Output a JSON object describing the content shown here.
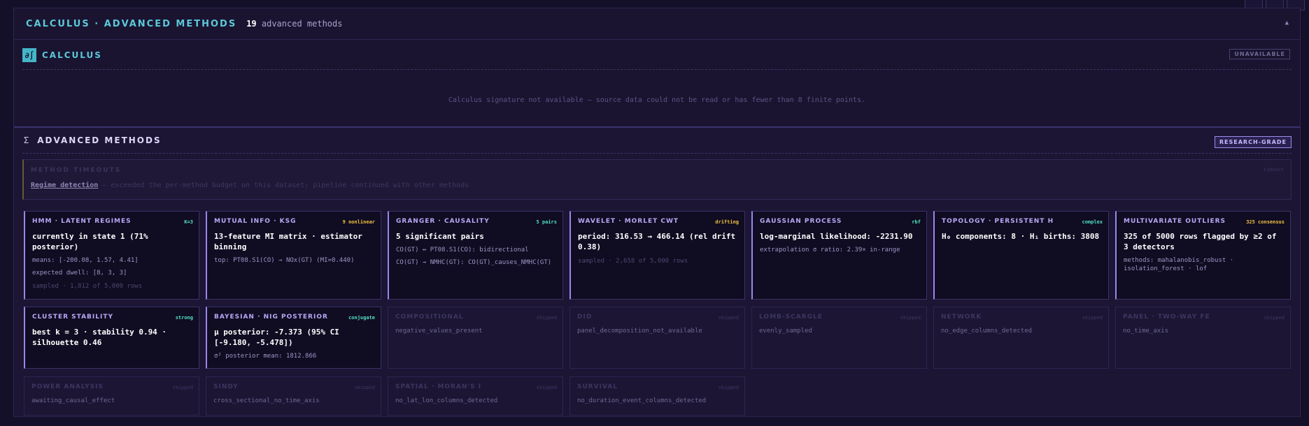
{
  "header": {
    "title": "Calculus · Advanced Methods",
    "count": "19",
    "count_suffix": " advanced methods",
    "toggle": "▲"
  },
  "calculus": {
    "icon": "∂∫",
    "title": "Calculus",
    "status": "Unavailable",
    "message": "Calculus signature not available — source data could not be read or has fewer than 8 finite points."
  },
  "advanced": {
    "symbol": "Σ",
    "title": "Advanced Methods",
    "badge": "Research-grade",
    "timeout": {
      "title": "Method Timeouts",
      "badge": "timeout",
      "method": "Regime detection",
      "message": " — exceeded the per-method budget on this dataset; pipeline continued with other methods"
    }
  },
  "cards": [
    {
      "title": "HMM · Latent Regimes",
      "badge": "K=3",
      "headline": "currently in state 1 (71% posterior)",
      "lines": [
        "means: [-200.08, 1.57, 4.41]",
        "expected dwell: [8, 3, 3]"
      ],
      "muted": "sampled · 1,812 of 5,000 rows"
    },
    {
      "title": "Mutual Info · KSG",
      "badge": "9 nonlinear",
      "headline": "13-feature MI matrix · estimator binning",
      "lines": [
        "top: PT08.S1(CO) → NOx(GT) (MI=0.440)"
      ]
    },
    {
      "title": "Granger · Causality",
      "badge": "5 pairs",
      "headline": "5 significant pairs",
      "lines": [
        "CO(GT) ↔ PT08.S1(CO): bidirectional",
        "CO(GT) → NMHC(GT): CO(GT)_causes_NMHC(GT)"
      ]
    },
    {
      "title": "Wavelet · Morlet CWT",
      "badge": "drifting",
      "headline": "period: 316.53 → 466.14 (rel drift 0.38)",
      "muted": "sampled · 2,658 of 5,000 rows"
    },
    {
      "title": "Gaussian Process",
      "badge": "rbf",
      "headline": "log-marginal likelihood: -2231.90",
      "lines": [
        "extrapolation σ ratio: 2.39× in-range"
      ]
    },
    {
      "title": "Topology · Persistent H",
      "badge": "complex",
      "headline": "H₀ components: 8 · H₁ births: 3808"
    },
    {
      "title": "Multivariate Outliers",
      "badge": "325 consensus",
      "headline": "325 of 5000 rows flagged by ≥2 of 3 detectors",
      "lines": [
        "methods: mahalanobis_robust · isolation_forest · lof"
      ]
    },
    {
      "title": "Cluster Stability",
      "badge": "strong",
      "headline": "best k = 3 · stability 0.94 · silhouette 0.46"
    },
    {
      "title": "Bayesian · NIG Posterior",
      "badge": "conjugate",
      "headline": "μ posterior: -7.373 (95% CI [-9.180, -5.478])",
      "lines": [
        "σ² posterior mean: 1812.866"
      ]
    },
    {
      "title": "Compositional",
      "badge": "skipped",
      "reason": "negative_values_present"
    },
    {
      "title": "DiD",
      "badge": "skipped",
      "reason": "panel_decomposition_not_available"
    },
    {
      "title": "Lomb-Scargle",
      "badge": "skipped",
      "reason": "evenly_sampled"
    },
    {
      "title": "Network",
      "badge": "skipped",
      "reason": "no_edge_columns_detected"
    },
    {
      "title": "Panel · Two-Way FE",
      "badge": "skipped",
      "reason": "no_time_axis"
    },
    {
      "title": "Power Analysis",
      "badge": "skipped",
      "reason": "awaiting_causal_effect"
    },
    {
      "title": "SINDy",
      "badge": "skipped",
      "reason": "cross_sectional_no_time_axis"
    },
    {
      "title": "Spatial · Moran's I",
      "badge": "skipped",
      "reason": "no_lat_lon_columns_detected"
    },
    {
      "title": "Survival",
      "badge": "skipped",
      "reason": "no_duration_event_columns_detected"
    }
  ]
}
